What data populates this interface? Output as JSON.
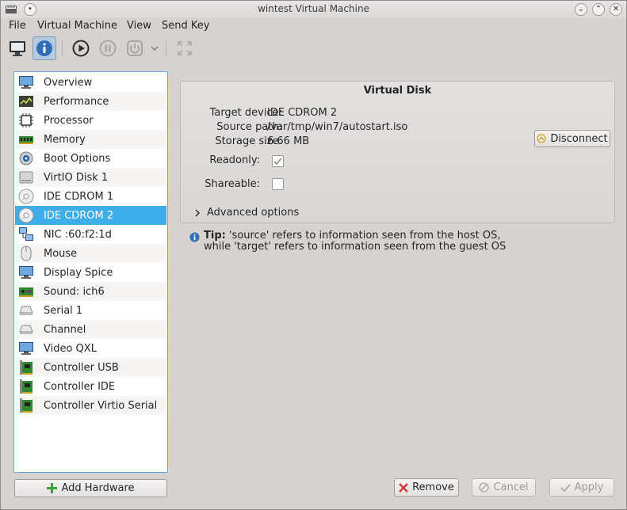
{
  "window": {
    "title": "wintest Virtual Machine"
  },
  "menu": {
    "file": "File",
    "vm": "Virtual Machine",
    "view": "View",
    "sendkey": "Send Key"
  },
  "sidebar": {
    "items": [
      {
        "label": "Overview",
        "icon": "monitor-icon"
      },
      {
        "label": "Performance",
        "icon": "performance-icon"
      },
      {
        "label": "Processor",
        "icon": "chip-icon"
      },
      {
        "label": "Memory",
        "icon": "memory-icon"
      },
      {
        "label": "Boot Options",
        "icon": "gear-icon"
      },
      {
        "label": "VirtIO Disk 1",
        "icon": "disk-icon"
      },
      {
        "label": "IDE CDROM 1",
        "icon": "cdrom-icon"
      },
      {
        "label": "IDE CDROM 2",
        "icon": "cdrom-icon",
        "selected": true
      },
      {
        "label": "NIC :60:f2:1d",
        "icon": "network-icon"
      },
      {
        "label": "Mouse",
        "icon": "mouse-icon"
      },
      {
        "label": "Display Spice",
        "icon": "display-icon"
      },
      {
        "label": "Sound: ich6",
        "icon": "sound-card-icon"
      },
      {
        "label": "Serial 1",
        "icon": "serial-icon"
      },
      {
        "label": "Channel",
        "icon": "channel-icon"
      },
      {
        "label": "Video QXL",
        "icon": "display-icon"
      },
      {
        "label": "Controller USB",
        "icon": "controller-icon"
      },
      {
        "label": "Controller IDE",
        "icon": "controller-icon"
      },
      {
        "label": "Controller Virtio Serial",
        "icon": "controller-icon"
      }
    ]
  },
  "buttons": {
    "add_hardware": "Add Hardware",
    "remove": "Remove",
    "cancel": "Cancel",
    "apply": "Apply",
    "disconnect": "Disconnect"
  },
  "panel": {
    "title": "Virtual Disk",
    "target_label": "Target device:",
    "target_value": "IDE CDROM 2",
    "source_label": "Source path:",
    "source_value": "/var/tmp/win7/autostart.iso",
    "size_label": "Storage size:",
    "size_value": "6.66 MB",
    "readonly_label": "Readonly:",
    "readonly_checked": true,
    "shareable_label": "Shareable:",
    "shareable_checked": false,
    "advanced_label": "Advanced options"
  },
  "tip": {
    "prefix": "Tip:",
    "line1": "'source' refers to information seen from the host OS,",
    "line2": "while 'target' refers to information seen from the guest OS"
  }
}
